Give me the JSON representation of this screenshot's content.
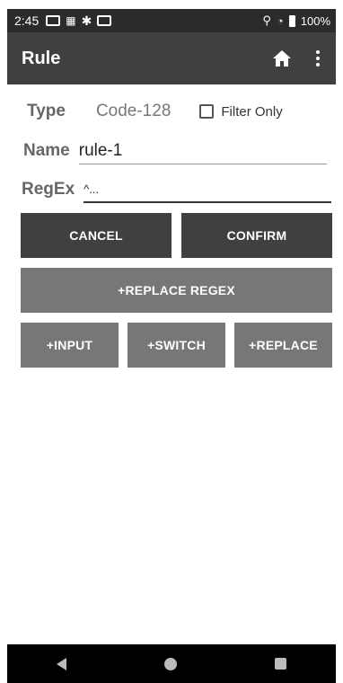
{
  "status": {
    "time": "2:45",
    "battery": "100%",
    "icons": [
      "notification-icon",
      "barcode-icon",
      "bluetooth-icon",
      "card-icon",
      "location-icon",
      "wifi-icon",
      "battery-icon"
    ]
  },
  "appbar": {
    "title": "Rule",
    "actions": [
      "home-icon",
      "more-icon"
    ]
  },
  "form": {
    "type_label": "Type",
    "type_value": "Code-128",
    "filter_only_label": "Filter Only",
    "filter_only_checked": false,
    "name_label": "Name",
    "name_value": "rule-1",
    "regex_label": "RegEx",
    "regex_value": "^..."
  },
  "buttons": {
    "cancel": "CANCEL",
    "confirm": "CONFIRM",
    "replace_regex": "+REPLACE REGEX",
    "input": "+INPUT",
    "switch": "+SWITCH",
    "replace": "+REPLACE"
  },
  "colors": {
    "appbar": "#404040",
    "status": "#2b2b2b",
    "button_dark": "#404040",
    "button_gray": "#777777"
  },
  "nav": {
    "icons": [
      "back-icon",
      "home-circle-icon",
      "recents-icon"
    ]
  }
}
